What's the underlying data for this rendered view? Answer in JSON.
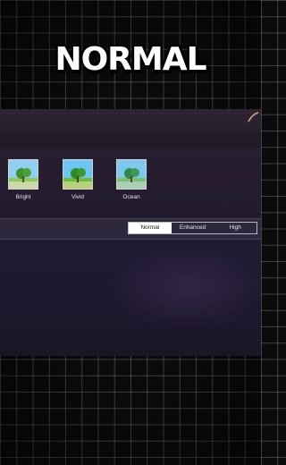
{
  "title": "NORMAL",
  "filters": {
    "items": [
      {
        "label": "Bright"
      },
      {
        "label": "Vivid"
      },
      {
        "label": "Ocean"
      }
    ]
  },
  "quality": {
    "options": [
      "Normal",
      "Enhanced",
      "High"
    ],
    "selected": "Normal"
  },
  "colors": {
    "selected_bg": "#ffffff",
    "panel_bg": "#241c2c",
    "grid_line": "#ffffff"
  }
}
